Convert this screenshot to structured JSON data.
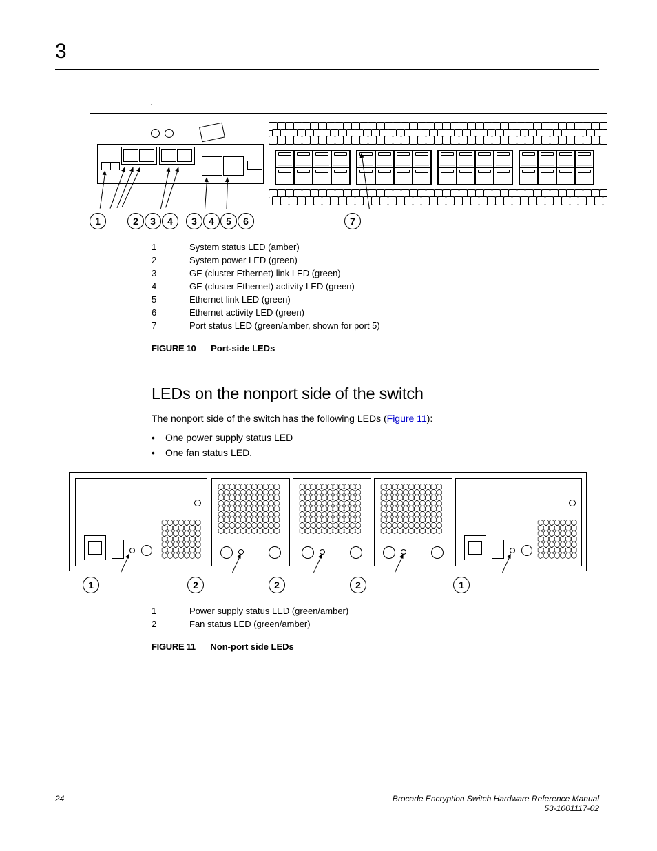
{
  "chapter": "3",
  "period": ".",
  "fig10": {
    "callouts": [
      "1",
      "2",
      "3",
      "4",
      "3",
      "4",
      "5",
      "6",
      "7"
    ],
    "legend": [
      {
        "n": "1",
        "t": "System status LED (amber)"
      },
      {
        "n": "2",
        "t": "System power LED (green)"
      },
      {
        "n": "3",
        "t": "GE (cluster Ethernet) link LED (green)"
      },
      {
        "n": "4",
        "t": "GE (cluster Ethernet) activity LED (green)"
      },
      {
        "n": "5",
        "t": "Ethernet link LED (green)"
      },
      {
        "n": "6",
        "t": "Ethernet activity LED (green)"
      },
      {
        "n": "7",
        "t": "Port status LED (green/amber, shown for port 5)"
      }
    ],
    "caption_label": "FIGURE 10",
    "caption_title": "Port-side LEDs"
  },
  "section_heading": "LEDs on the nonport side of the switch",
  "section_para_pre": "The nonport side of the switch has the following LEDs (",
  "section_para_link": "Figure 11",
  "section_para_post": "):",
  "bullets": [
    "One power supply status LED",
    "One fan status LED."
  ],
  "fig11": {
    "callouts": [
      "1",
      "2",
      "2",
      "2",
      "1"
    ],
    "legend": [
      {
        "n": "1",
        "t": "Power supply status LED (green/amber)"
      },
      {
        "n": "2",
        "t": "Fan status LED (green/amber)"
      }
    ],
    "caption_label": "FIGURE 11",
    "caption_title": "Non-port side LEDs"
  },
  "footer": {
    "page": "24",
    "title": "Brocade Encryption Switch Hardware Reference Manual",
    "docnum": "53-1001117-02"
  }
}
